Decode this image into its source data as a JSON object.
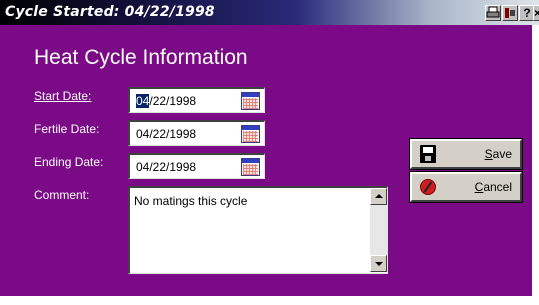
{
  "window": {
    "title": "Cycle Started: 04/22/1998",
    "titlebar_buttons": [
      {
        "icon": "print-icon"
      },
      {
        "icon": "tools-icon"
      },
      {
        "label": "?"
      },
      {
        "label": "×"
      }
    ]
  },
  "form": {
    "heading": "Heat Cycle Information",
    "start_date": {
      "label": "Start Date:",
      "value_selected": "04",
      "value_rest": "/22/1998",
      "icon": "calendar-icon"
    },
    "fertile_date": {
      "label": "Fertile Date:",
      "value": "04/22/1998",
      "icon": "calendar-icon"
    },
    "ending_date": {
      "label": "Ending Date:",
      "value": "04/22/1998",
      "icon": "calendar-icon"
    },
    "comment": {
      "label": "Comment:",
      "value": "No matings this cycle"
    }
  },
  "buttons": {
    "save": {
      "label_first": "S",
      "label_rest": "ave",
      "icon": "floppy-disk-icon"
    },
    "cancel": {
      "label_first": "C",
      "label_rest": "ancel",
      "icon": "cancel-icon"
    }
  },
  "colors": {
    "client_background": "#7a0a85",
    "title_text": "#ffffff"
  }
}
